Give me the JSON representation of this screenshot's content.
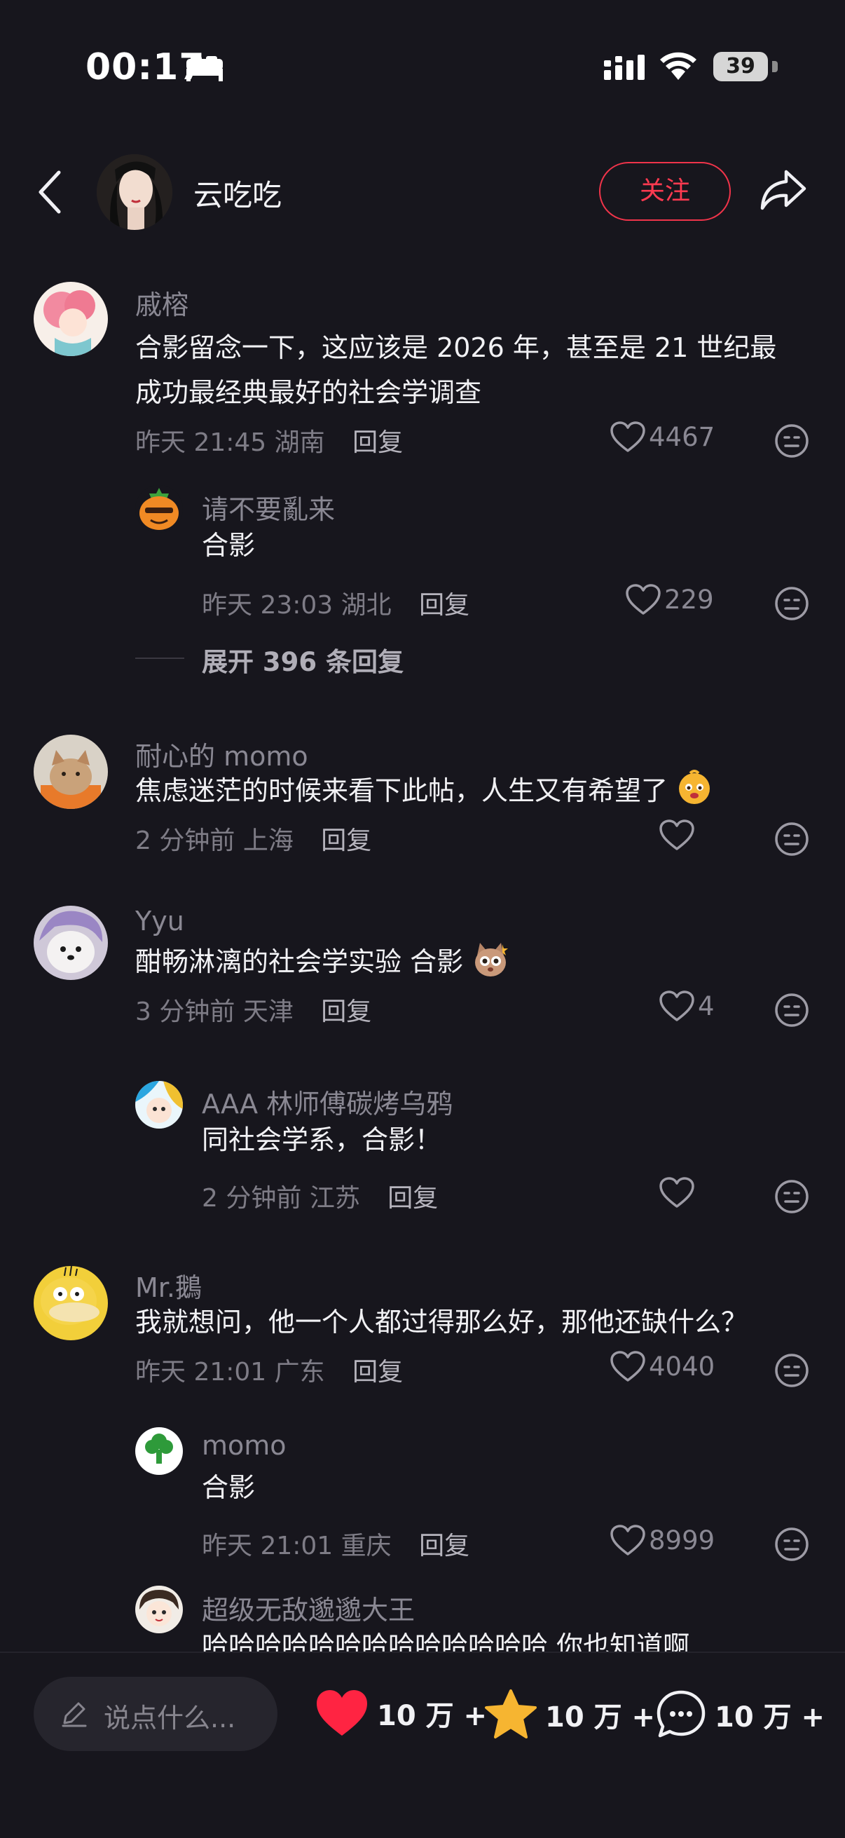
{
  "status_bar": {
    "time": "00:17",
    "battery": "39"
  },
  "header": {
    "title": "云吃吃",
    "follow_label": "关注"
  },
  "comments": [
    {
      "user": "戚榕",
      "text_lines": [
        "合影留念一下，这应该是 2026 年，甚至是 21 世纪最",
        "成功最经典最好的社会学调查"
      ],
      "time": "昨天 21:45",
      "location": "湖南",
      "reply_label": "回复",
      "likes": "4467",
      "replies": [
        {
          "user": "请不要亂来",
          "text": "合影",
          "time": "昨天 23:03",
          "location": "湖北",
          "reply_label": "回复",
          "likes": "229"
        }
      ],
      "expand_label": "展开 396 条回复"
    },
    {
      "user": "耐心的 momo",
      "text": "焦虑迷茫的时候来看下此帖，人生又有希望了",
      "time": "2 分钟前",
      "location": "上海",
      "reply_label": "回复",
      "likes": ""
    },
    {
      "user": "Yyu",
      "text": "酣畅淋漓的社会学实验 合影",
      "time": "3 分钟前",
      "location": "天津",
      "reply_label": "回复",
      "likes": "4",
      "replies": [
        {
          "user": "AAA 林师傅碳烤乌鸦",
          "text": "同社会学系，合影！",
          "time": "2 分钟前",
          "location": "江苏",
          "reply_label": "回复",
          "likes": ""
        }
      ]
    },
    {
      "user": "Mr.鵝",
      "text": "我就想问，他一个人都过得那么好，那他还缺什么？",
      "time": "昨天 21:01",
      "location": "广东",
      "reply_label": "回复",
      "likes": "4040",
      "replies": [
        {
          "user": "momo",
          "text": "合影",
          "time": "昨天 21:01",
          "location": "重庆",
          "reply_label": "回复",
          "likes": "8999"
        },
        {
          "user": "超级无敌邈邈大王",
          "text": "哈哈哈哈哈哈哈哈哈哈哈哈哈 你也知道啊"
        }
      ]
    }
  ],
  "bottom_bar": {
    "input_placeholder": "说点什么...",
    "likes_count": "10 万 +",
    "favorites_count": "10 万 +",
    "comments_count": "10 万 +"
  },
  "icons": {
    "back": "chevron-left-icon",
    "share": "share-arrow-icon",
    "like": "heart-outline-icon",
    "dislike": "neutral-face-icon",
    "pen": "pen-icon",
    "like_filled": "heart-filled-icon",
    "star": "star-filled-icon",
    "comment": "chat-bubble-icon"
  },
  "colors": {
    "accent": "#ff3a50",
    "background": "#17161d",
    "star": "#f6b531"
  }
}
